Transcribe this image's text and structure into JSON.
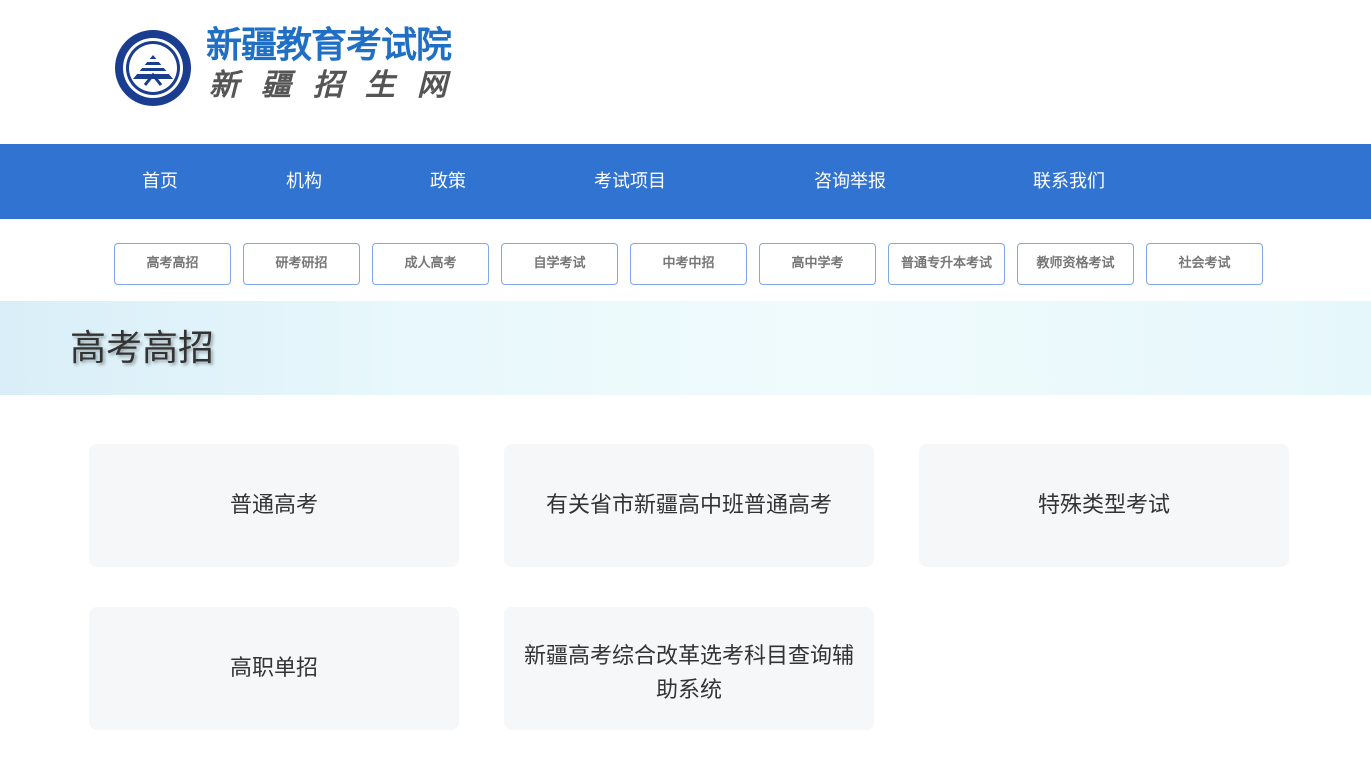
{
  "header": {
    "title": "新疆教育考试院",
    "subtitle": "新疆招生网",
    "emblem_icon": "exam-authority-emblem-icon"
  },
  "main_nav": [
    {
      "label": "首页"
    },
    {
      "label": "机构"
    },
    {
      "label": "政策"
    },
    {
      "label": "考试项目"
    },
    {
      "label": "咨询举报"
    },
    {
      "label": "联系我们"
    }
  ],
  "sub_nav": [
    {
      "label": "高考高招"
    },
    {
      "label": "研考研招"
    },
    {
      "label": "成人高考"
    },
    {
      "label": "自学考试"
    },
    {
      "label": "中考中招"
    },
    {
      "label": "高中学考"
    },
    {
      "label": "普通专升本考试"
    },
    {
      "label": "教师资格考试"
    },
    {
      "label": "社会考试"
    }
  ],
  "banner": {
    "title": "高考高招"
  },
  "cards": [
    {
      "label": "普通高考"
    },
    {
      "label": "有关省市新疆高中班普通高考"
    },
    {
      "label": "特殊类型考试"
    },
    {
      "label": "高职单招"
    },
    {
      "label": "新疆高考综合改革选考科目查询辅助系统"
    }
  ],
  "colors": {
    "nav_bg": "#3173d0",
    "title_blue": "#1f6fc5",
    "button_border": "#7fa9e4",
    "card_bg": "#f6f7f9"
  }
}
